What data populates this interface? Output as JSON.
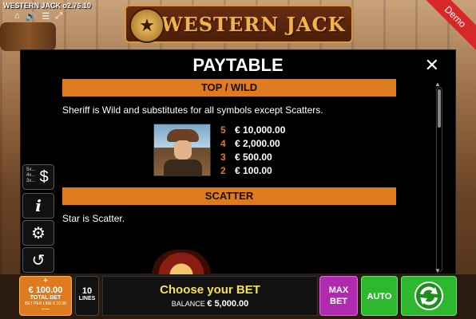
{
  "header": {
    "version": "WESTERN JACK o2.76.10",
    "logo_text": "WESTERN JACK",
    "demo_label": "Demo",
    "icons": [
      "home-icon",
      "speaker-icon",
      "menu-icon",
      "fullscreen-icon"
    ]
  },
  "paytable": {
    "title": "PAYTABLE",
    "close_symbol": "✕",
    "sections": [
      {
        "heading": "TOP / WILD",
        "description": "Sheriff is Wild and substitutes for all symbols except Scatters.",
        "pays": [
          {
            "count": "5",
            "amount": "€ 10,000.00"
          },
          {
            "count": "4",
            "amount": "€ 2,000.00"
          },
          {
            "count": "3",
            "amount": "€ 500.00"
          },
          {
            "count": "2",
            "amount": "€ 100.00"
          }
        ]
      },
      {
        "heading": "SCATTER",
        "description": "Star is Scatter."
      }
    ]
  },
  "side_buttons": {
    "paytable_symbol": "$",
    "multipliers": [
      "5x...",
      "4x...",
      "3x..."
    ],
    "info_symbol": "i",
    "settings_icon": "gear-icon",
    "history_icon": "history-icon"
  },
  "bottom_bar": {
    "bet_plus": "+",
    "bet_value": "€ 100.00",
    "bet_label": "TOTAL BET",
    "bet_per_line": "BET PER LINE € 10.00",
    "bet_minus": "—",
    "lines_value": "10",
    "lines_label": "LINES",
    "message": "Choose your BET",
    "balance_label": "BALANCE",
    "balance_value": "€ 5,000.00",
    "max_bet_label": "MAX BET",
    "auto_label": "AUTO",
    "spin_icon": "spin-icon"
  },
  "colors": {
    "accent_orange": "#e07a1f",
    "max_bet_purple": "#b02ab0",
    "spin_green": "#2eb82e",
    "message_yellow": "#f6e24a"
  }
}
